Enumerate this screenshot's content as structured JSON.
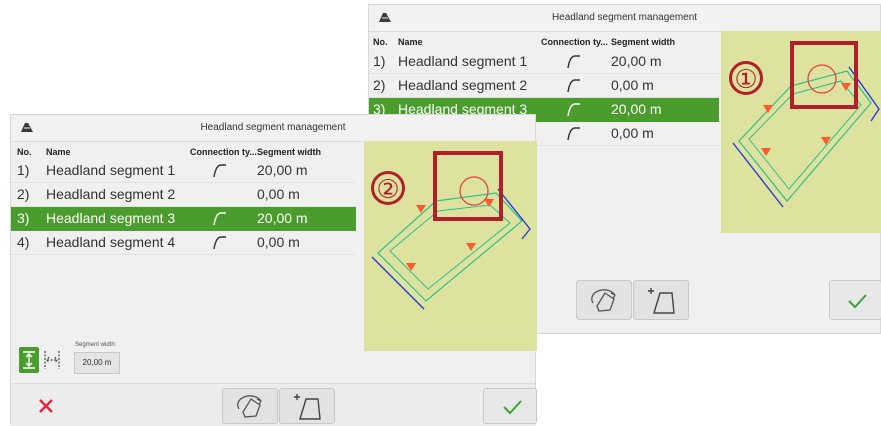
{
  "dialog": {
    "title": "Headland segment management",
    "columns": {
      "no": "No.",
      "name": "Name",
      "connection": "Connection ty...",
      "width": "Segment width"
    },
    "rows": [
      {
        "no": "1)",
        "name": "Headland segment 1",
        "width": "20,00 m"
      },
      {
        "no": "2)",
        "name": "Headland segment 2",
        "width": "0,00 m"
      },
      {
        "no": "3)",
        "name": "Headland segment 3",
        "width": "20,00 m"
      },
      {
        "no": "4)",
        "name": "Headland segment 4",
        "width": "0,00 m"
      }
    ],
    "segment_width_label": "Segment width:",
    "segment_width_value": "20,00 m"
  },
  "back_dialog": {
    "callout": "①",
    "visible_rows": [
      {
        "no": "1)",
        "name": "Headland segment 1",
        "width": "20,00 m"
      },
      {
        "no": "2)",
        "name": "Headland segment 2",
        "width": "0,00 m"
      },
      {
        "no": "3)",
        "name": "Headland segment 3",
        "width": "20,00 m"
      },
      {
        "no": "",
        "name": "",
        "width": "0,00 m"
      }
    ]
  },
  "front_dialog": {
    "callout": "②"
  },
  "icons": [
    "app-logo-icon",
    "connection-type-icon",
    "rotate-field-icon",
    "add-segment-icon",
    "checkmark-icon",
    "close-icon"
  ],
  "colors": {
    "selected_row": "#4a9d2c",
    "map_bg": "#dde39e",
    "callout_red": "#b11f2b",
    "confirm_green": "#3aa33a",
    "cancel_red": "#e0263a"
  }
}
